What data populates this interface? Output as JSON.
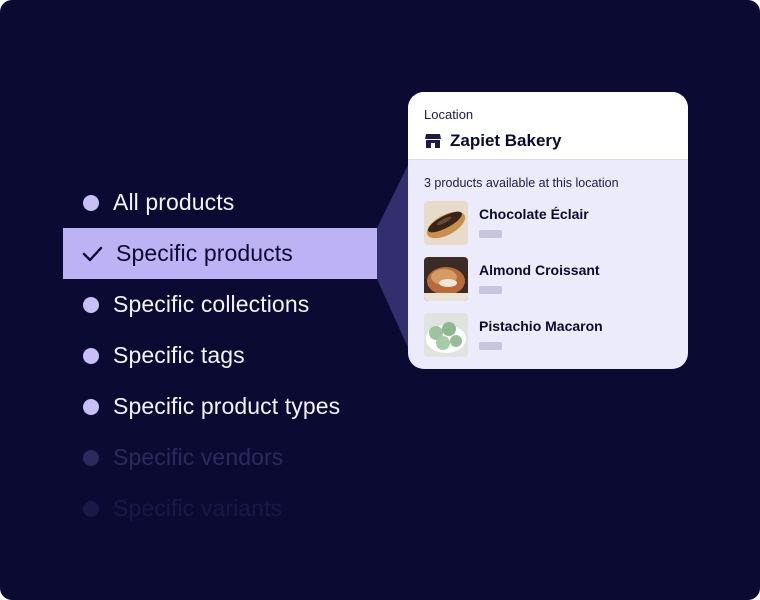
{
  "options": [
    {
      "label": "All products",
      "state": "normal"
    },
    {
      "label": "Specific products",
      "state": "selected"
    },
    {
      "label": "Specific collections",
      "state": "normal"
    },
    {
      "label": "Specific tags",
      "state": "normal"
    },
    {
      "label": "Specific product types",
      "state": "normal"
    },
    {
      "label": "Specific vendors",
      "state": "faded"
    },
    {
      "label": "Specific variants",
      "state": "faded"
    }
  ],
  "popover": {
    "location_label": "Location",
    "location_name": "Zapiet Bakery",
    "location_icon": "store-icon",
    "availability_text": "3 products available at this location",
    "products": [
      {
        "name": "Chocolate Éclair",
        "thumbnail": "eclair-photo"
      },
      {
        "name": "Almond Croissant",
        "thumbnail": "croissant-photo"
      },
      {
        "name": "Pistachio Macaron",
        "thumbnail": "macaron-photo"
      }
    ]
  },
  "colors": {
    "background": "#0b0a33",
    "accent": "#bdb2f3",
    "dot": "#c9bff7",
    "card": "#ecebfb"
  }
}
